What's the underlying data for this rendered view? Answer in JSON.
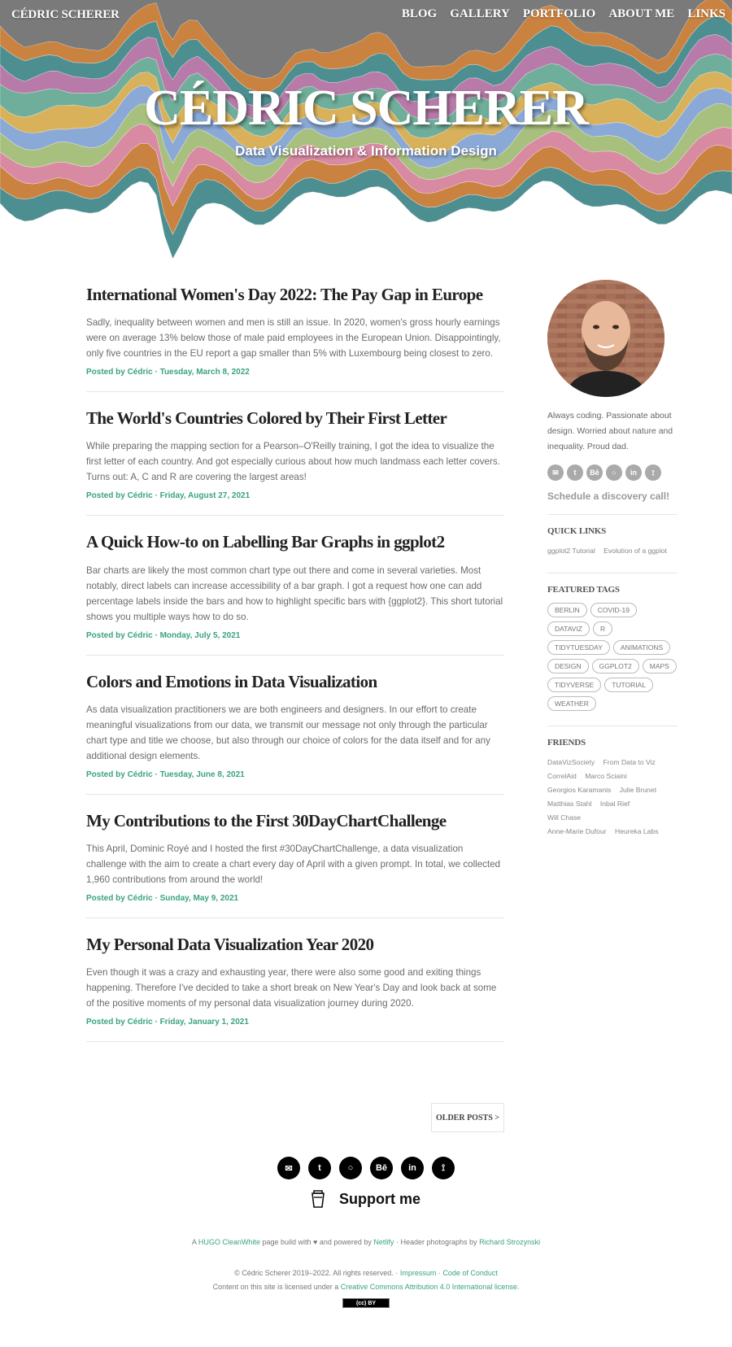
{
  "header": {
    "brand": "CÉDRIC SCHERER",
    "nav": [
      "BLOG",
      "GALLERY",
      "PORTFOLIO",
      "ABOUT ME",
      "LINKS"
    ],
    "title": "CÉDRIC SCHERER",
    "subtitle": "Data Visualization & Information Design"
  },
  "posts": [
    {
      "title": "International Women's Day 2022: The Pay Gap in Europe",
      "excerpt": "Sadly, inequality between women and men is still an issue. In 2020, women's gross hourly earnings were on average 13% below those of male paid employees in the European Union. Disappointingly, only five countries in the EU report a gap smaller than 5% with Luxembourg being closest to zero.",
      "meta": "Posted by Cédric · Tuesday, March 8, 2022"
    },
    {
      "title": "The World's Countries Colored by Their First Letter",
      "excerpt": "While preparing the mapping section for a Pearson–O'Reilly training, I got the idea to visualize the first letter of each country. And got especially curious about how much landmass each letter covers. Turns out: A, C and R are covering the largest areas!",
      "meta": "Posted by Cédric · Friday, August 27, 2021"
    },
    {
      "title": "A Quick How-to on Labelling Bar Graphs in ggplot2",
      "excerpt": "Bar charts are likely the most common chart type out there and come in several varieties. Most notably, direct labels can increase accessibility of a bar graph. I got a request how one can add percentage labels inside the bars and how to highlight specific bars with {ggplot2}. This short tutorial shows you multiple ways how to do so.",
      "meta": "Posted by Cédric · Monday, July 5, 2021"
    },
    {
      "title": "Colors and Emotions in Data Visualization",
      "excerpt": "As data visualization practitioners we are both engineers and designers. In our effort to create meaningful visualizations from our data, we transmit our message not only through the particular chart type and title we choose, but also through our choice of colors for the data itself and for any additional design elements.",
      "meta": "Posted by Cédric · Tuesday, June 8, 2021"
    },
    {
      "title": "My Contributions to the First 30DayChartChallenge",
      "excerpt": "This April, Dominic Royé and I hosted the first #30DayChartChallenge, a data visualization challenge with the aim to create a chart every day of April with a given prompt. In total, we collected 1,960 contributions from around the world!",
      "meta": "Posted by Cédric · Sunday, May 9, 2021"
    },
    {
      "title": "My Personal Data Visualization Year 2020",
      "excerpt": "Even though it was a crazy and exhausting year, there were also some good and exiting things happening. Therefore I've decided to take a short break on New Year's Day and look back at some of the positive moments of my personal data visualization journey during 2020.",
      "meta": "Posted by Cédric · Friday, January 1, 2021"
    }
  ],
  "pager": {
    "older": "OLDER POSTS >"
  },
  "sidebar": {
    "bio": "Always coding. Passionate about design. Worried about nature and inequality. Proud dad.",
    "social_icons": [
      "email-icon",
      "twitter-icon",
      "behance-icon",
      "github-icon",
      "linkedin-icon",
      "rss-icon"
    ],
    "social_glyphs": [
      "✉",
      "t",
      "Bē",
      "○",
      "in",
      "⟟"
    ],
    "cta": "Schedule a discovery call!",
    "quick_links_title": "QUICK LINKS",
    "quick_links": [
      "ggplot2 Tutorial",
      "Evolution of a ggplot"
    ],
    "tags_title": "FEATURED TAGS",
    "tags": [
      "BERLIN",
      "COVID-19",
      "DATAVIZ",
      "R",
      "TIDYTUESDAY",
      "ANIMATIONS",
      "DESIGN",
      "GGPLOT2",
      "MAPS",
      "TIDYVERSE",
      "TUTORIAL",
      "WEATHER"
    ],
    "friends_title": "FRIENDS",
    "friends": [
      "DataVizSociety",
      "From Data to Viz",
      "CorrelAid",
      "Marco Sciaini",
      "Georgios Karamanis",
      "Julie Brunet",
      "Matthias Stahl",
      "Inbal Rief",
      "Will Chase",
      "Anne-Marie Dufour",
      "Heureka Labs"
    ]
  },
  "footer": {
    "icons": [
      "email-icon",
      "twitter-icon",
      "github-icon",
      "behance-icon",
      "linkedin-icon",
      "rss-icon"
    ],
    "glyphs": [
      "✉",
      "t",
      "○",
      "Bē",
      "in",
      "⟟"
    ],
    "support": "Support me",
    "line1": {
      "a": "A",
      "hugo": "HUGO CleanWhite",
      "b": "page build with ♥ and powered by",
      "netlify": "Netlify",
      "sep": "·",
      "c": "Header photographs by",
      "photographer": "Richard Strozynski"
    },
    "line2": {
      "copyright": "© Cédric Scherer 2019–2022. All rights reserved.",
      "sep": "·",
      "impressum": "Impressum",
      "conduct": "Code of Conduct"
    },
    "line3": {
      "text": "Content on this site is licensed under a",
      "license": "Creative Commons Attribution 4.0 International license."
    },
    "cc_badge": "(cc) BY"
  },
  "colors": {
    "accent": "#3aa37b",
    "hero_bg": "#7a7a7a",
    "stream": [
      "#4d8f91",
      "#c9823f",
      "#d98aa3",
      "#a8c07e",
      "#8aa9d6",
      "#d8b15a",
      "#6fae9a",
      "#b77aa9"
    ]
  }
}
